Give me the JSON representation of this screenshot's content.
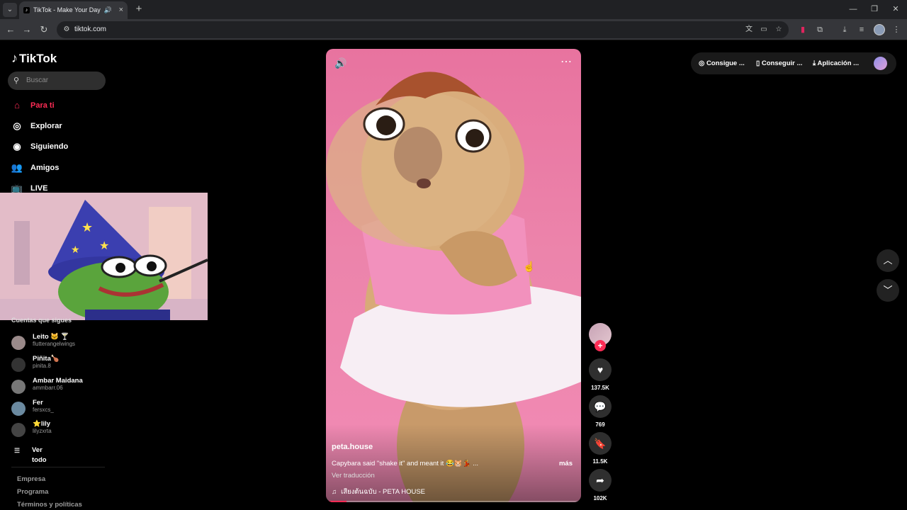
{
  "browser": {
    "tab_title": "TikTok - Make Your Day",
    "tab_favicon": "tiktok-logo-icon",
    "url": "tiktok.com",
    "new_tab_symbol": "+",
    "tab_close_symbol": "×",
    "minimize_symbol": "—",
    "restore_symbol": "❐",
    "close_symbol": "✕"
  },
  "sidebar": {
    "logo": "TikTok",
    "search_placeholder": "Buscar",
    "nav": [
      {
        "label": "Para ti",
        "icon": "home-icon",
        "active": true
      },
      {
        "label": "Explorar",
        "icon": "compass-icon"
      },
      {
        "label": "Siguiendo",
        "icon": "following-icon"
      },
      {
        "label": "Amigos",
        "icon": "friends-icon"
      },
      {
        "label": "LIVE",
        "icon": "live-icon"
      }
    ],
    "following_heading": "Cuentas que sigues",
    "accounts": [
      {
        "name": "Leito 🐱 🍸",
        "handle": "flutterangelwings"
      },
      {
        "name": "Piñita🍗",
        "handle": "pinita.8"
      },
      {
        "name": "Ambar Maidana",
        "handle": "ammbarr.06"
      },
      {
        "name": "Fer",
        "handle": "fersxcs_"
      },
      {
        "name": "⭐lily",
        "handle": "lilyzxrta"
      }
    ],
    "see_all": "Ver todo",
    "footer": [
      "Empresa",
      "Programa",
      "Términos y políticas"
    ]
  },
  "video": {
    "author": "peta.house",
    "caption": "Capybara said \"shake it\" and meant it 😂🐹💃 ...",
    "more": "más",
    "translate": "Ver traducción",
    "music": "เสียงต้นฉบับ - PETA HOUSE",
    "progress": 0.08
  },
  "actions": {
    "likes": "137.5K",
    "comments": "769",
    "saves": "11.5K",
    "shares": "102K"
  },
  "header_actions": {
    "coins": "Consigue ...",
    "get_app": "Conseguir ...",
    "desktop_app": "Aplicación ..."
  },
  "colors": {
    "accent": "#fe2c55",
    "background": "#000000",
    "video_bg": "#ec84ab"
  }
}
